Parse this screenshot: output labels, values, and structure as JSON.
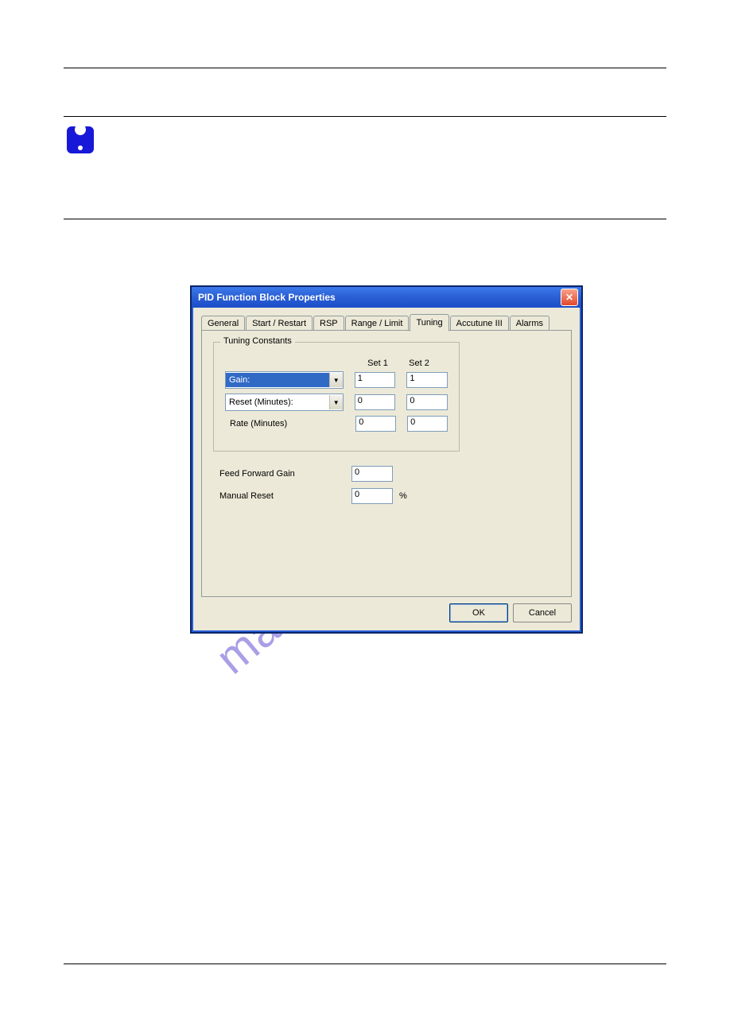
{
  "watermark": "manualshive.com",
  "dialog": {
    "title": "PID Function Block Properties",
    "tabs": [
      "General",
      "Start / Restart",
      "RSP",
      "Range / Limit",
      "Tuning",
      "Accutune III",
      "Alarms"
    ],
    "active_tab": "Tuning",
    "groupbox_title": "Tuning Constants",
    "col_headers": [
      "Set 1",
      "Set 2"
    ],
    "rows": [
      {
        "label": "Gain:",
        "type": "dropdown",
        "selected": true,
        "set1": "1",
        "set2": "1"
      },
      {
        "label": "Reset (Minutes):",
        "type": "dropdown",
        "selected": false,
        "set1": "0",
        "set2": "0"
      },
      {
        "label": "Rate (Minutes)",
        "type": "plain",
        "set1": "0",
        "set2": "0"
      }
    ],
    "below": [
      {
        "label": "Feed Forward Gain",
        "value": "0",
        "unit": ""
      },
      {
        "label": "Manual Reset",
        "value": "0",
        "unit": "%"
      }
    ],
    "buttons": {
      "ok": "OK",
      "cancel": "Cancel"
    }
  }
}
